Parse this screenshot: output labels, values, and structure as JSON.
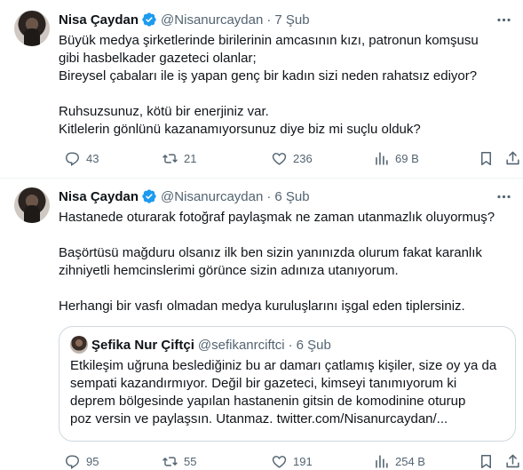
{
  "tweets": [
    {
      "author": "Nisa Çaydan",
      "handle": "@Nisanurcaydan",
      "separator": "·",
      "time": "7 Şub",
      "lines": [
        "Büyük medya şirketlerinde birilerinin amcasının kızı, patronun komşusu",
        "gibi hasbelkader gazeteci olanlar;",
        "Bireysel çabaları ile iş yapan genç bir kadın sizi neden rahatsız ediyor?",
        "",
        "Ruhsuzsunuz, kötü bir enerjiniz var.",
        "Kitlelerin gönlünü kazanamıyorsunuz diye biz mi suçlu olduk?"
      ],
      "replies": "43",
      "retweets": "21",
      "likes": "236",
      "views": "69 B"
    },
    {
      "author": "Nisa Çaydan",
      "handle": "@Nisanurcaydan",
      "separator": "·",
      "time": "6 Şub",
      "lines": [
        "Hastanede oturarak fotoğraf paylaşmak ne zaman utanmazlık oluyormuş?",
        "",
        "Başörtüsü mağduru olsanız ilk ben sizin yanınızda olurum fakat  karanlık",
        "zihniyetli hemcinslerimi görünce sizin adınıza utanıyorum.",
        "",
        "Herhangi bir vasfı olmadan medya kuruluşlarını işgal eden tiplersiniz."
      ],
      "quote": {
        "author": "Şefika Nur Çiftçi",
        "handle": "@sefikanrciftci",
        "separator": "·",
        "time": "6 Şub",
        "lines": [
          "Etkileşim uğruna beslediğiniz bu ar damarı çatlamış kişiler, size oy ya da",
          "sempati kazandırmıyor. Değil bir gazeteci, kimseyi tanımıyorum ki",
          "deprem bölgesinde yapılan hastanenin gitsin de komodinine oturup",
          "poz versin ve paylaşsın. Utanmaz. twitter.com/Nisanurcaydan/..."
        ]
      },
      "replies": "95",
      "retweets": "55",
      "likes": "191",
      "views": "254 B"
    }
  ],
  "icons": {
    "verified": "verified-badge-icon",
    "more": "more-icon",
    "reply": "reply-icon",
    "retweet": "retweet-icon",
    "like": "heart-icon",
    "views": "analytics-icon",
    "bookmark": "bookmark-icon",
    "share": "share-icon"
  },
  "colors": {
    "text": "#0f1419",
    "secondary": "#536471",
    "verified": "#1d9bf0",
    "border": "#cfd9de"
  }
}
